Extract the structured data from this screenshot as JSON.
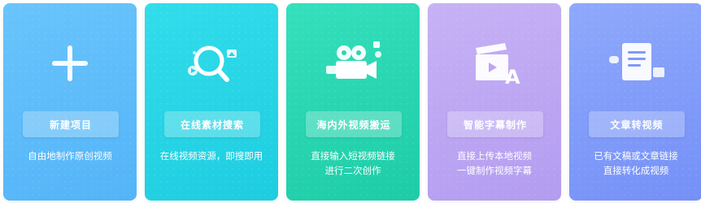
{
  "cards": [
    {
      "icon": "plus-icon",
      "button": "新建项目",
      "desc_lines": [
        "自由地制作原创视频"
      ],
      "color": "#5ab9f9"
    },
    {
      "icon": "search-magnifier-icon",
      "button": "在线素材搜索",
      "desc_lines": [
        "在线视频资源，即搜即用"
      ],
      "color": "#26d4e5"
    },
    {
      "icon": "video-camera-icon",
      "button": "海内外视频搬运",
      "desc_lines": [
        "直接输入短视频链接",
        "进行二次创作"
      ],
      "color": "#27d6b1"
    },
    {
      "icon": "clapperboard-subtitle-icon",
      "button": "智能字幕制作",
      "desc_lines": [
        "直接上传本地视频",
        "一键制作视频字幕"
      ],
      "color": "#bca6f2"
    },
    {
      "icon": "document-to-video-icon",
      "button": "文章转视频",
      "desc_lines": [
        "已有文稿或文章链接",
        "直接转化成视频"
      ],
      "color": "#7f9af8"
    }
  ]
}
